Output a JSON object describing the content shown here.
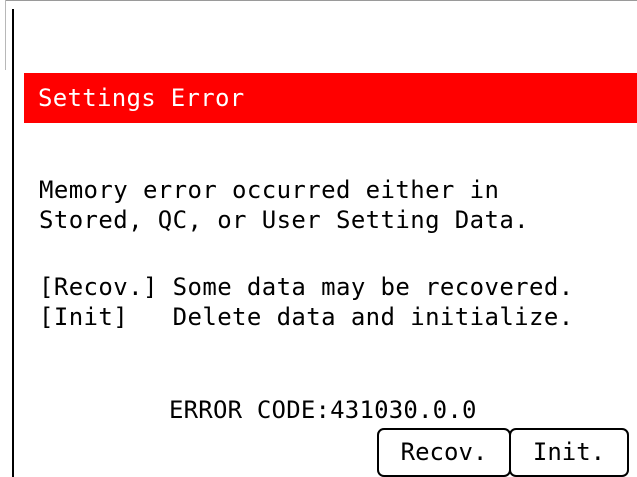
{
  "dialog": {
    "title": "Settings Error",
    "message_lines": [
      "Memory error occurred either in",
      "Stored, QC, or User Setting Data."
    ],
    "options": [
      "[Recov.] Some data may be recovered.",
      "[Init]   Delete data and initialize."
    ],
    "error_code": "ERROR CODE:431030.0.0"
  },
  "buttons": {
    "recover_label": "Recov.",
    "init_label": "Init."
  },
  "colors": {
    "title_background": "#ff0000",
    "title_text": "#ffffff",
    "text": "#000000",
    "background": "#ffffff"
  }
}
